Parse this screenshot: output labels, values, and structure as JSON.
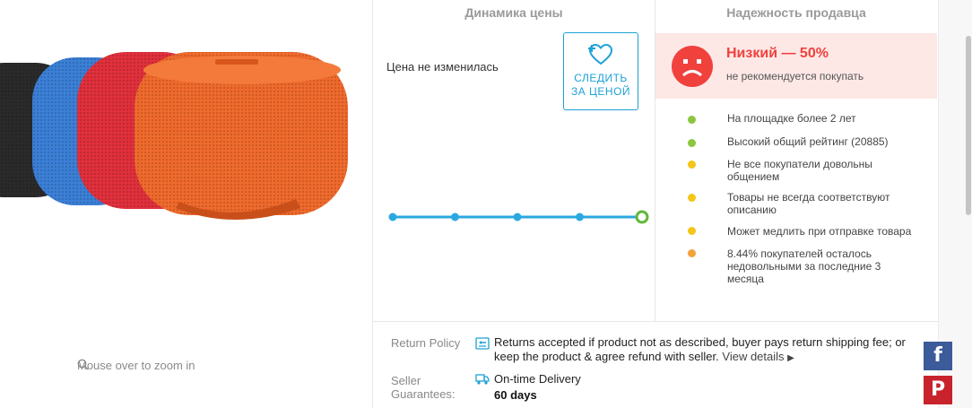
{
  "product": {
    "zoom_hint": "Mouse over to zoom in"
  },
  "price_panel": {
    "title": "Динамика цены",
    "status": "Цена не изменилась",
    "follow_button": {
      "line1": "СЛЕДИТЬ",
      "line2": "ЗА ЦЕНОЙ"
    }
  },
  "chart_data": {
    "type": "line",
    "x": [
      1,
      2,
      3,
      4,
      5
    ],
    "values": [
      1,
      1,
      1,
      1,
      1
    ],
    "title": "",
    "xlabel": "",
    "ylabel": "",
    "grid": false,
    "colors": {
      "line": "#2aa8e0",
      "last_point": "#5fb83a"
    }
  },
  "seller_panel": {
    "title": "Надежность продавца",
    "rating_level": "Низкий — 50%",
    "rating_note": "не рекомендуется покупать",
    "features": [
      {
        "text": "На площадке более 2 лет",
        "color": "#8cc63f"
      },
      {
        "text": "Высокий общий рейтинг (20885)",
        "color": "#8cc63f"
      },
      {
        "text": "Не все покупатели довольны общением",
        "color": "#f5c518"
      },
      {
        "text": "Товары не всегда соответствуют описанию",
        "color": "#f5c518"
      },
      {
        "text": "Может медлить при отправке товара",
        "color": "#f5c518"
      },
      {
        "text": "8.44% покупателей осталось недовольными за последние 3 месяца",
        "color": "#f2a33a"
      }
    ]
  },
  "policy": {
    "return_label": "Return Policy",
    "return_text": "Returns accepted if product not as described, buyer pays return shipping fee; or keep the product & agree refund with seller.",
    "return_link": "View details",
    "guarantee_label_1": "Seller",
    "guarantee_label_2": "Guarantees:",
    "guarantee_text": "On-time Delivery",
    "guarantee_days": "60 days"
  },
  "social": {
    "facebook": "f",
    "pinterest": "P"
  },
  "colors": {
    "accent": "#1ea2d6",
    "danger": "#f0413d",
    "danger_bg": "#fde8e6"
  }
}
